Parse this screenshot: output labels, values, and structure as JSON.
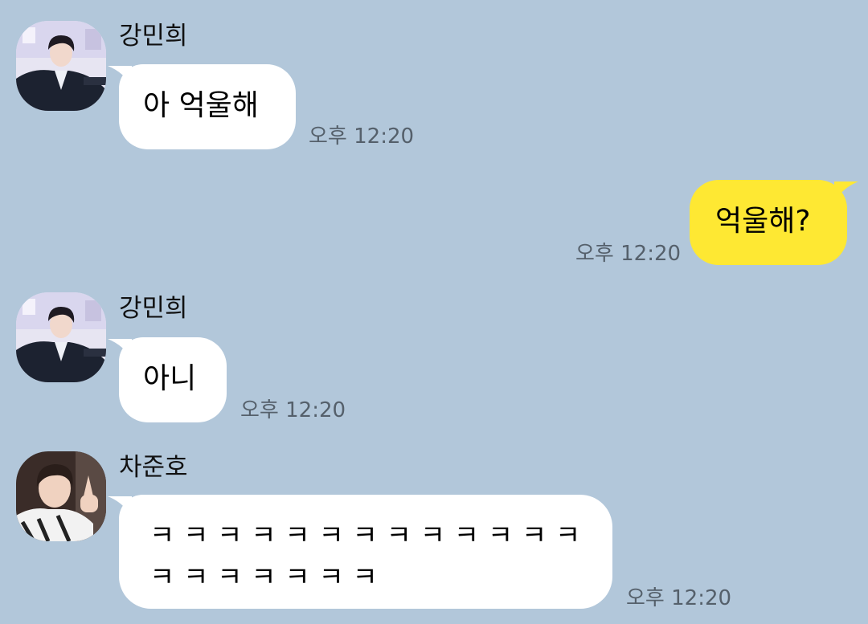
{
  "messages": [
    {
      "sender": "강민희",
      "text": "아 억울해",
      "time": "오후 12:20"
    },
    {
      "text": "억울해?",
      "time": "오후 12:20"
    },
    {
      "sender": "강민희",
      "text": "아니",
      "time": "오후 12:20"
    },
    {
      "sender": "차준호",
      "lines": [
        "ㅋ ㅋ ㅋ ㅋ ㅋ ㅋ ㅋ ㅋ ㅋ ㅋ ㅋ ㅋ ㅋ",
        "ㅋ ㅋ ㅋ ㅋ ㅋ ㅋ ㅋ"
      ],
      "time": "오후 12:20"
    }
  ],
  "colors": {
    "background": "#b2c7da",
    "incoming_bubble": "#ffffff",
    "outgoing_bubble": "#fee833",
    "timestamp": "#55606b"
  },
  "icons": {
    "avatar_1": "profile-photo-man-in-suit",
    "avatar_2": "profile-photo-young-man-v-sign"
  }
}
